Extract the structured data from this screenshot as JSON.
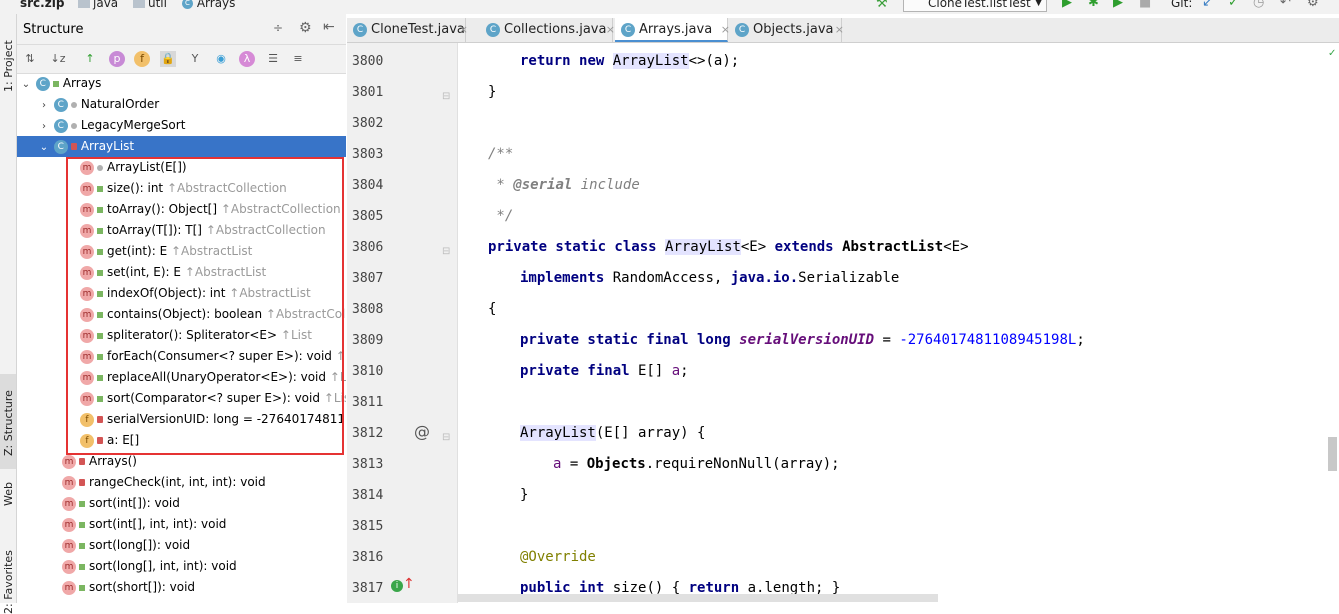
{
  "breadcrumb": {
    "items": [
      "src.zip",
      "java",
      "util",
      "Arrays"
    ],
    "run_config": "CloneTest.listTest",
    "git_label": "Git:"
  },
  "left_strip": {
    "tabs": [
      "1: Project",
      "Z: Structure",
      "Web",
      "2: Favorites"
    ]
  },
  "structure": {
    "title": "Structure",
    "tree": [
      {
        "text": "Arrays",
        "hint": ""
      },
      {
        "text": "NaturalOrder",
        "hint": ""
      },
      {
        "text": "LegacyMergeSort",
        "hint": ""
      },
      {
        "text": "ArrayList",
        "hint": ""
      },
      {
        "text": "ArrayList(E[])",
        "hint": ""
      },
      {
        "text": "size(): int",
        "hint": "↑AbstractCollection"
      },
      {
        "text": "toArray(): Object[]",
        "hint": "↑AbstractCollection"
      },
      {
        "text": "toArray(T[]): T[]",
        "hint": "↑AbstractCollection"
      },
      {
        "text": "get(int): E",
        "hint": "↑AbstractList"
      },
      {
        "text": "set(int, E): E",
        "hint": "↑AbstractList"
      },
      {
        "text": "indexOf(Object): int",
        "hint": "↑AbstractList"
      },
      {
        "text": "contains(Object): boolean",
        "hint": "↑AbstractColl"
      },
      {
        "text": "spliterator(): Spliterator<E>",
        "hint": "↑List"
      },
      {
        "text": "forEach(Consumer<? super E>): void",
        "hint": "↑I"
      },
      {
        "text": "replaceAll(UnaryOperator<E>): void",
        "hint": "↑Li"
      },
      {
        "text": "sort(Comparator<? super E>): void",
        "hint": "↑Lis"
      },
      {
        "text": "serialVersionUID: long = -27640174811",
        "hint": ""
      },
      {
        "text": "a: E[]",
        "hint": ""
      },
      {
        "text": "Arrays()",
        "hint": ""
      },
      {
        "text": "rangeCheck(int, int, int): void",
        "hint": ""
      },
      {
        "text": "sort(int[]): void",
        "hint": ""
      },
      {
        "text": "sort(int[], int, int): void",
        "hint": ""
      },
      {
        "text": "sort(long[]): void",
        "hint": ""
      },
      {
        "text": "sort(long[], int, int): void",
        "hint": ""
      },
      {
        "text": "sort(short[]): void",
        "hint": ""
      }
    ]
  },
  "tabs": [
    {
      "label": "CloneTest.java"
    },
    {
      "label": "Collections.java"
    },
    {
      "label": "Arrays.java"
    },
    {
      "label": "Objects.java"
    }
  ],
  "editor": {
    "line_numbers": [
      "3800",
      "3801",
      "3802",
      "3803",
      "3804",
      "3805",
      "3806",
      "3807",
      "3808",
      "3809",
      "3810",
      "3811",
      "3812",
      "3813",
      "3814",
      "3815",
      "3816",
      "3817"
    ],
    "code": {
      "l3800_ret": "return",
      "l3800_new": "new",
      "l3800_cls": "ArrayList",
      "l3800_rest": "<>(a);",
      "l3801": "}",
      "l3803": "/**",
      "l3804_a": " * ",
      "l3804_tag": "@serial",
      "l3804_b": " include",
      "l3805": " */",
      "l3806_kw": "private static class",
      "l3806_cls": "ArrayList",
      "l3806_gen": "<E>",
      "l3806_ext": "extends",
      "l3806_sup": "AbstractList",
      "l3806_gen2": "<E>",
      "l3807_kw": "implements",
      "l3807_a": " RandomAccess, ",
      "l3807_pkg": "java.io.",
      "l3807_b": "Serializable",
      "l3808": "{",
      "l3809_kw": "private static final long",
      "l3809_fld": "serialVersionUID",
      "l3809_eq": " = ",
      "l3809_num": "-2764017481108945198L",
      "l3809_end": ";",
      "l3810_kw": "private final",
      "l3810_t": " E[] ",
      "l3810_fld": "a",
      "l3810_end": ";",
      "l3812_cls": "ArrayList",
      "l3812_rest": "(E[] array) {",
      "l3813_fld": "a",
      "l3813_a": " = ",
      "l3813_cls": "Objects",
      "l3813_b": ".requireNonNull(array);",
      "l3814": "}",
      "l3816": "@Override",
      "l3817_kw": "public int",
      "l3817_a": " size() { ",
      "l3817_ret": "return",
      "l3817_b": " a.length; }"
    }
  }
}
